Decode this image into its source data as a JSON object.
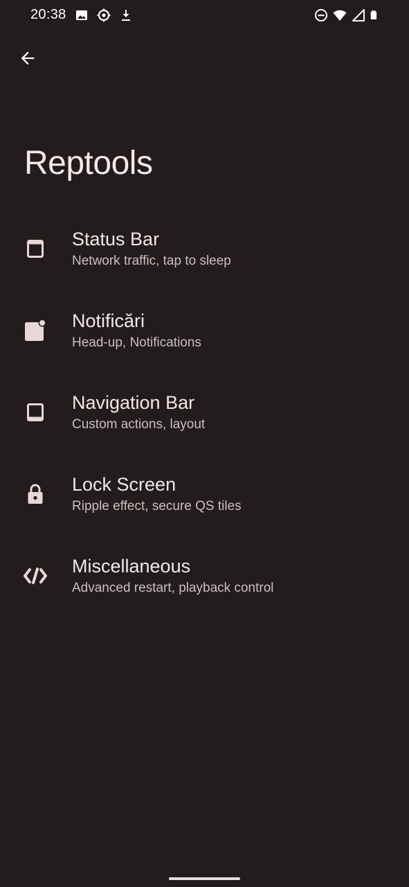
{
  "status_bar": {
    "time": "20:38",
    "left_icons": [
      "image-icon",
      "settings-sync-icon",
      "download-icon"
    ],
    "right_icons": [
      "do-not-disturb-icon",
      "wifi-icon",
      "cellular-signal-icon",
      "battery-icon"
    ]
  },
  "header": {
    "back_icon": "arrow-back-icon",
    "title": "Reptools"
  },
  "menu": {
    "items": [
      {
        "icon": "status-bar-icon",
        "title": "Status Bar",
        "subtitle": "Network traffic, tap to sleep"
      },
      {
        "icon": "notification-icon",
        "title": "Notificări",
        "subtitle": "Head-up, Notifications"
      },
      {
        "icon": "navigation-bar-icon",
        "title": "Navigation Bar",
        "subtitle": "Custom actions, layout"
      },
      {
        "icon": "lock-icon",
        "title": "Lock Screen",
        "subtitle": "Ripple effect, secure QS tiles"
      },
      {
        "icon": "code-icon",
        "title": "Miscellaneous",
        "subtitle": "Advanced restart, playback control"
      }
    ]
  },
  "colors": {
    "background": "#221c1c",
    "text_primary": "#f4e8e6",
    "text_secondary": "#cdbfbd",
    "icon": "#e9d6d6"
  }
}
